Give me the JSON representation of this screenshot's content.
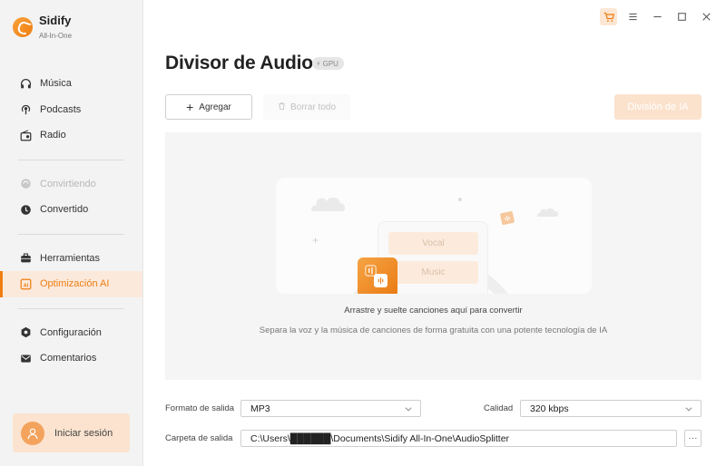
{
  "app": {
    "name": "Sidify",
    "subtitle": "All-In-One",
    "accent_color": "#ef7d11"
  },
  "sidebar": {
    "items": [
      {
        "label": "Música",
        "icon": "headphones-icon",
        "state": "normal"
      },
      {
        "label": "Podcasts",
        "icon": "podcast-icon",
        "state": "normal"
      },
      {
        "label": "Radio",
        "icon": "radio-icon",
        "state": "normal"
      },
      {
        "label": "Convirtiendo",
        "icon": "converting-icon",
        "state": "disabled"
      },
      {
        "label": "Convertido",
        "icon": "clock-icon",
        "state": "normal"
      },
      {
        "label": "Herramientas",
        "icon": "toolbox-icon",
        "state": "normal"
      },
      {
        "label": "Optimización AI",
        "icon": "ai-icon",
        "state": "active"
      },
      {
        "label": "Configuración",
        "icon": "gear-icon",
        "state": "normal"
      },
      {
        "label": "Comentarios",
        "icon": "mail-icon",
        "state": "normal"
      }
    ],
    "login_label": "Iniciar sesión"
  },
  "window_controls": [
    "cart-icon",
    "menu-icon",
    "minimize-icon",
    "maximize-icon",
    "close-icon"
  ],
  "main": {
    "title": "Divisor de Audio",
    "gpu_badge": "GPU",
    "add_label": "Agregar",
    "clear_label": "Borrar todo",
    "split_ai_label": "División de IA",
    "dropzone": {
      "vocal": "Vocal",
      "music": "Music",
      "drop_text": "Arrastre y suelte canciones aquí para convertir",
      "sub_text": "Separa la voz y la música de canciones de forma gratuita con una potente tecnología de IA"
    },
    "output_format": {
      "label": "Formato de salida",
      "value": "MP3"
    },
    "quality": {
      "label": "Calidad",
      "value": "320 kbps"
    },
    "output_folder": {
      "label": "Carpeta de salida",
      "value": "C:\\Users\\██████\\Documents\\Sidify All-In-One\\AudioSplitter",
      "browse": "···"
    }
  }
}
